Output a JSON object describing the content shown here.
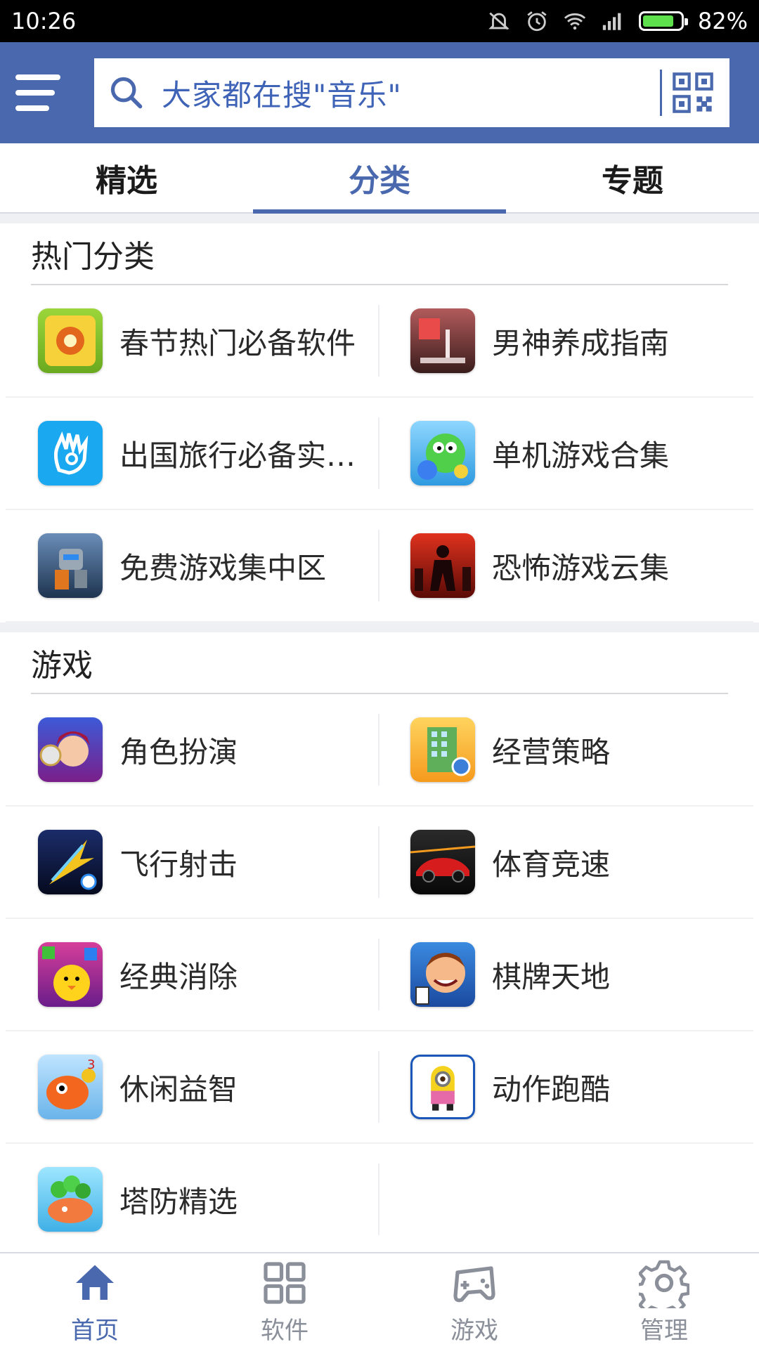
{
  "status_bar": {
    "time": "10:26",
    "battery": "82%",
    "battery_level": 0.82
  },
  "header": {
    "search_placeholder": "大家都在搜\"音乐\""
  },
  "tabs": [
    {
      "label": "精选",
      "active": false
    },
    {
      "label": "分类",
      "active": true
    },
    {
      "label": "专题",
      "active": false
    }
  ],
  "sections": [
    {
      "title": "热门分类",
      "items": [
        {
          "label": "春节热门必备软件",
          "icon": "recipe-app-icon"
        },
        {
          "label": "男神养成指南",
          "icon": "success-app-icon"
        },
        {
          "label": "出国旅行必备实用...",
          "icon": "hand-app-icon"
        },
        {
          "label": "单机游戏合集",
          "icon": "bubble-dragon-icon"
        },
        {
          "label": "免费游戏集中区",
          "icon": "robot-game-icon"
        },
        {
          "label": "恐怖游戏云集",
          "icon": "horror-game-icon"
        }
      ]
    },
    {
      "title": "游戏",
      "items": [
        {
          "label": "角色扮演",
          "icon": "role-play-icon"
        },
        {
          "label": "经营策略",
          "icon": "building-strategy-icon"
        },
        {
          "label": "飞行射击",
          "icon": "jet-shooter-icon"
        },
        {
          "label": "体育竞速",
          "icon": "racing-car-icon"
        },
        {
          "label": "经典消除",
          "icon": "match-puzzle-icon"
        },
        {
          "label": "棋牌天地",
          "icon": "card-game-icon"
        },
        {
          "label": "休闲益智",
          "icon": "fish-game-icon"
        },
        {
          "label": "动作跑酷",
          "icon": "minion-runner-icon"
        },
        {
          "label": "塔防精选",
          "icon": "tower-defense-icon"
        }
      ]
    }
  ],
  "bottom_nav": [
    {
      "label": "首页",
      "icon": "home-icon",
      "active": true
    },
    {
      "label": "软件",
      "icon": "apps-grid-icon",
      "active": false
    },
    {
      "label": "游戏",
      "icon": "gamepad-icon",
      "active": false
    },
    {
      "label": "管理",
      "icon": "settings-gear-icon",
      "active": false
    }
  ],
  "colors": {
    "brand": "#4a68ad",
    "search_text": "#3f63b6",
    "battery": "#5ee04c"
  }
}
